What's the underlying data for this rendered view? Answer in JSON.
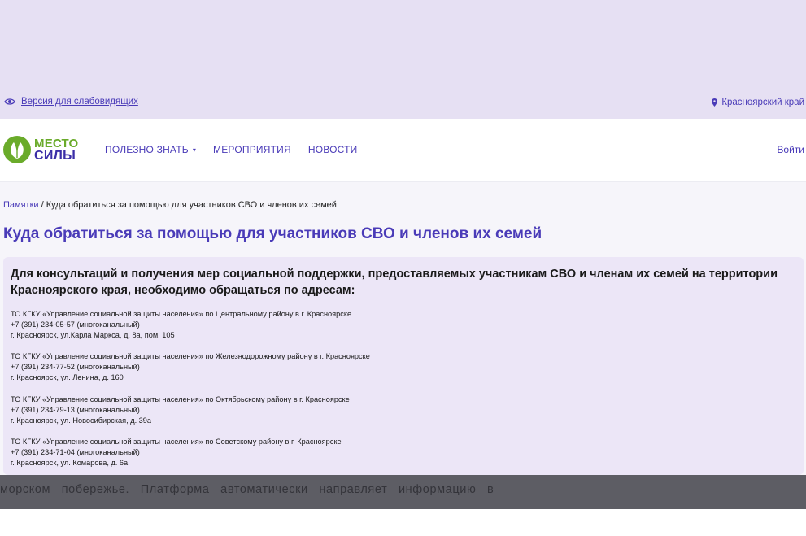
{
  "topbar": {
    "a11y_label": "Версия для слабовидящих",
    "region_label": "Красноярский край"
  },
  "logo": {
    "line1": "МЕСТО",
    "line2": "СИЛЫ"
  },
  "nav": {
    "items": [
      {
        "label": "ПОЛЕЗНО ЗНАТЬ",
        "has_dropdown": true
      },
      {
        "label": "МЕРОПРИЯТИЯ"
      },
      {
        "label": "НОВОСТИ"
      }
    ],
    "login_label": "Войти"
  },
  "breadcrumb": {
    "parent": "Памятки",
    "separator": "/",
    "current": "Куда обратиться за помощью для участников СВО и членов их семей"
  },
  "page_title": "Куда обратиться за помощью для участников СВО и членов их семей",
  "card": {
    "heading": "Для консультаций и получения мер социальной поддержки, предоставляемых участникам СВО и членам их семей на территории Красноярского края, необходимо обращаться по адресам:",
    "addresses": [
      {
        "name": "ТО КГКУ «Управление социальной защиты населения» по Центральному району в г. Красноярске",
        "phone": "+7 (391) 234-05-57 (многоканальный)",
        "address": "г. Красноярск, ул.Карла Маркса, д. 8а, пом. 105"
      },
      {
        "name": "ТО КГКУ «Управление социальной защиты населения» по Железнодорожному району в г. Красноярске",
        "phone": "+7 (391) 234-77-52 (многоканальный)",
        "address": "г. Красноярск, ул. Ленина, д. 160"
      },
      {
        "name": "ТО КГКУ «Управление социальной защиты населения» по Октябрьскому району в г. Красноярске",
        "phone": "+7 (391) 234-79-13 (многоканальный)",
        "address": "г. Красноярск, ул. Новосибирская, д. 39а"
      },
      {
        "name": "ТО КГКУ «Управление социальной защиты населения» по Советскому району в г. Красноярске",
        "phone": "+7 (391) 234-71-04 (многоканальный)",
        "address": "г. Красноярск, ул. Комарова, д. 6а"
      }
    ]
  },
  "overlay": {
    "line2": "морском побережье. Платформа автоматически направляет информацию в"
  },
  "colors": {
    "accent": "#4a3bb8",
    "topbar_bg": "#e6e0f3",
    "card_bg": "#ece6f7",
    "logo_green": "#6aab2a",
    "overlay_bg": "#5d5d64"
  },
  "icons": {
    "a11y": "eye-icon",
    "region": "location-pin-icon",
    "logo": "leaf-logo-icon",
    "dropdown": "chevron-down-icon"
  }
}
